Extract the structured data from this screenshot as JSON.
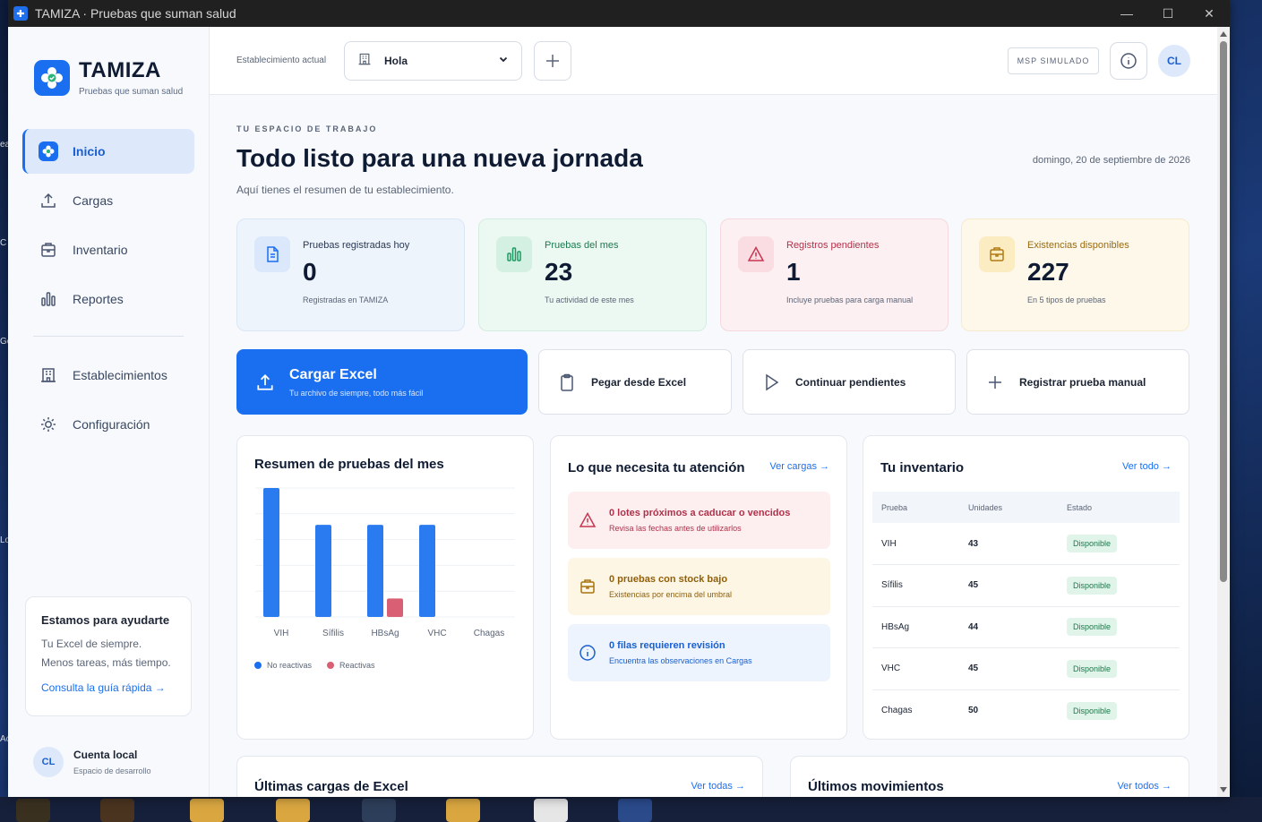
{
  "window": {
    "title": "TAMIZA · Pruebas que suman salud",
    "controls": [
      "—",
      "☐",
      "✕"
    ]
  },
  "brand": {
    "name": "TAMIZA",
    "tagline": "Pruebas que suman salud"
  },
  "sidebar": {
    "items": [
      {
        "label": "Inicio",
        "icon": "home-logo-icon",
        "active": true
      },
      {
        "label": "Cargas",
        "icon": "upload-icon"
      },
      {
        "label": "Inventario",
        "icon": "inventory-box-icon"
      },
      {
        "label": "Reportes",
        "icon": "bar-chart-icon"
      }
    ],
    "secondary_items": [
      {
        "label": "Establecimientos",
        "icon": "building-icon"
      },
      {
        "label": "Configuración",
        "icon": "gear-icon"
      }
    ],
    "help": {
      "title": "Estamos para ayudarte",
      "line1": "Tu Excel de siempre.",
      "line2": "Menos tareas, más tiempo.",
      "link": "Consulta la guía rápida →"
    },
    "account": {
      "initials": "CL",
      "name": "Cuenta local",
      "subtitle": "Espacio de desarrollo"
    }
  },
  "topbar": {
    "estab_label": "Establecimiento actual",
    "estab_value": "Hola",
    "badge": "MSP SIMULADO",
    "avatar": "CL"
  },
  "page": {
    "eyebrow": "TU ESPACIO DE TRABAJO",
    "title": "Todo listo para una nueva jornada",
    "subtitle": "Aquí tienes el resumen de tu establecimiento.",
    "date": "domingo, 20 de septiembre de 2026"
  },
  "stats": [
    {
      "label": "Pruebas registradas hoy",
      "value": "0",
      "note": "Registradas en TAMIZA",
      "icon": "document-icon"
    },
    {
      "label": "Pruebas del mes",
      "value": "23",
      "note": "Tu actividad de este mes",
      "icon": "bar-chart-icon"
    },
    {
      "label": "Registros pendientes",
      "value": "1",
      "note": "Incluye pruebas para carga manual",
      "icon": "warning-icon"
    },
    {
      "label": "Existencias disponibles",
      "value": "227",
      "note": "En 5 tipos de pruebas",
      "icon": "box-icon"
    }
  ],
  "actions": {
    "primary": {
      "title": "Cargar Excel",
      "subtitle": "Tu archivo de siempre, todo más fácil"
    },
    "paste": "Pegar desde Excel",
    "continue": "Continuar pendientes",
    "manual": "Registrar prueba manual"
  },
  "chart_card": {
    "title": "Resumen de pruebas del mes"
  },
  "chart_data": {
    "type": "bar",
    "categories": [
      "VIH",
      "Sífilis",
      "HBsAg",
      "VHC",
      "Chagas"
    ],
    "series": [
      {
        "name": "No reactivas",
        "values": [
          7,
          5,
          5,
          5,
          0
        ],
        "color": "#2a7af0"
      },
      {
        "name": "Reactivas",
        "values": [
          0,
          0,
          1,
          0,
          0
        ],
        "color": "#d96074"
      }
    ],
    "ylim": [
      0,
      7
    ],
    "grid": true,
    "legend": "bottom-left"
  },
  "attention": {
    "title": "Lo que necesita tu atención",
    "link": "Ver cargas →",
    "alerts": [
      {
        "title": "0 lotes próximos a caducar o vencidos",
        "subtitle": "Revisa las fechas antes de utilizarlos",
        "icon": "warning-icon"
      },
      {
        "title": "0 pruebas con stock bajo",
        "subtitle": "Existencias por encima del umbral",
        "icon": "box-icon"
      },
      {
        "title": "0 filas requieren revisión",
        "subtitle": "Encuentra las observaciones en Cargas",
        "icon": "info-icon"
      }
    ]
  },
  "inventory": {
    "title": "Tu inventario",
    "link": "Ver todo →",
    "columns": [
      "Prueba",
      "Unidades",
      "Estado"
    ],
    "rows": [
      {
        "name": "VIH",
        "units": "43",
        "status": "Disponible"
      },
      {
        "name": "Sífilis",
        "units": "45",
        "status": "Disponible"
      },
      {
        "name": "HBsAg",
        "units": "44",
        "status": "Disponible"
      },
      {
        "name": "VHC",
        "units": "45",
        "status": "Disponible"
      },
      {
        "name": "Chagas",
        "units": "50",
        "status": "Disponible"
      }
    ]
  },
  "bottom": {
    "uploads": {
      "title": "Últimas cargas de Excel",
      "link": "Ver todas →"
    },
    "movements": {
      "title": "Últimos movimientos",
      "link": "Ver todos →"
    }
  }
}
